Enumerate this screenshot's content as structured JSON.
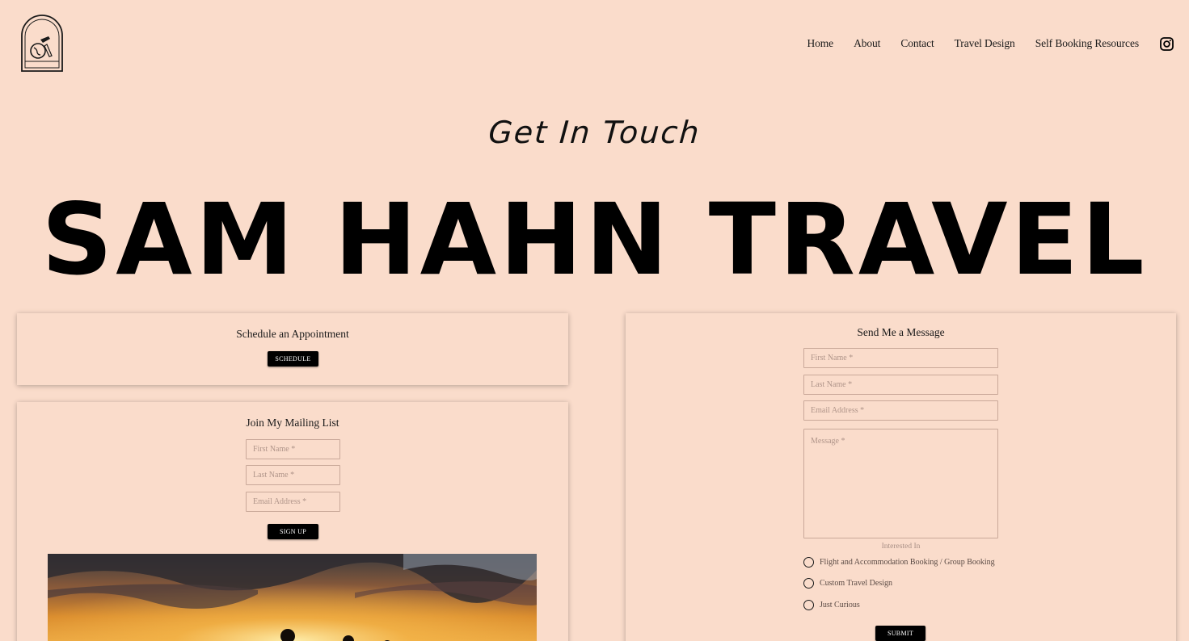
{
  "brand": {
    "logo_top_text": "SAM HAHN",
    "logo_bottom_text": "TRAVEL"
  },
  "nav": {
    "items": [
      {
        "label": "Home"
      },
      {
        "label": "About"
      },
      {
        "label": "Contact"
      },
      {
        "label": "Travel Design"
      },
      {
        "label": "Self Booking Resources"
      }
    ],
    "social_icon": "instagram-icon"
  },
  "hero": {
    "subtitle": "Get In Touch",
    "title": "SAM HAHN TRAVEL"
  },
  "appointment": {
    "title": "Schedule an Appointment",
    "button": "SCHEDULE"
  },
  "mailing": {
    "title": "Join My Mailing List",
    "first_name_placeholder": "First Name *",
    "last_name_placeholder": "Last Name *",
    "email_placeholder": "Email Address *",
    "button": "SIGN UP"
  },
  "message_form": {
    "title": "Send Me a Message",
    "first_name_placeholder": "First Name *",
    "last_name_placeholder": "Last Name *",
    "email_placeholder": "Email Address *",
    "message_placeholder": "Message *",
    "interested_label": "Interested In",
    "options": [
      {
        "label": "Flight and Accommodation Booking / Group Booking"
      },
      {
        "label": "Custom Travel Design"
      },
      {
        "label": "Just Curious"
      }
    ],
    "button": "SUBMIT"
  },
  "colors": {
    "background": "#fadccb",
    "button": "#000000",
    "text": "#1a1a1a"
  }
}
